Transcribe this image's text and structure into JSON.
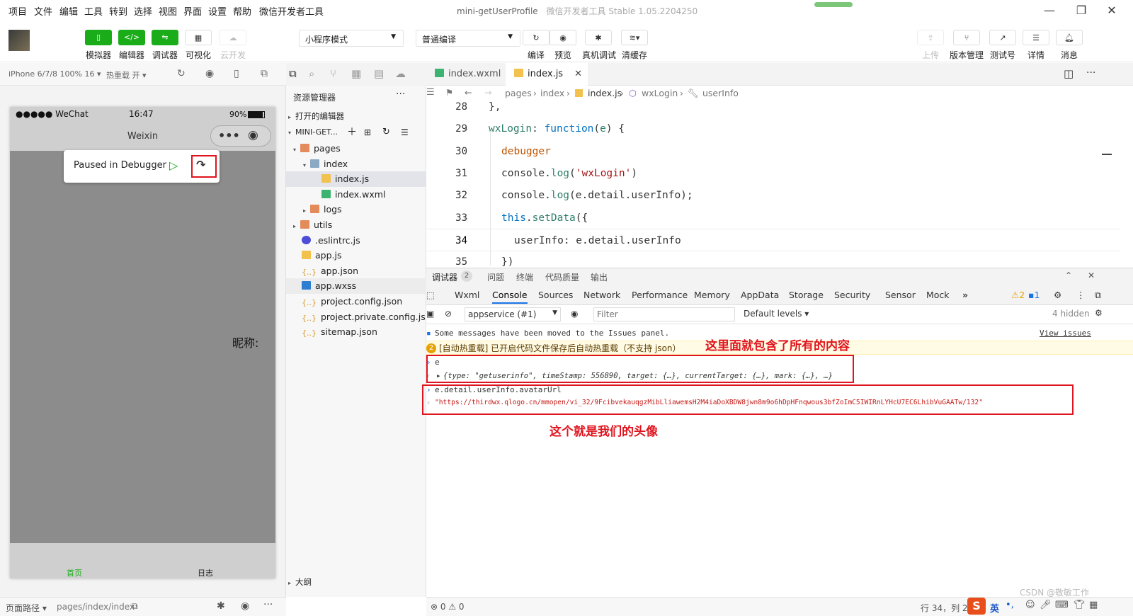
{
  "menu": [
    "项目",
    "文件",
    "编辑",
    "工具",
    "转到",
    "选择",
    "视图",
    "界面",
    "设置",
    "帮助",
    "微信开发者工具"
  ],
  "window": {
    "title": "mini-getUserProfile",
    "subtitle": "微信开发者工具 Stable 1.05.2204250"
  },
  "toolbar": {
    "buttons": [
      {
        "label": "模拟器",
        "icon": "phone-icon"
      },
      {
        "label": "编辑器",
        "icon": "code-icon"
      },
      {
        "label": "调试器",
        "icon": "debug-icon"
      },
      {
        "label": "可视化",
        "icon": "layout-icon"
      },
      {
        "label": "云开发",
        "icon": "cloud-icon"
      }
    ],
    "mode_select": "小程序模式",
    "compile_select": "普通编译",
    "actions": [
      "编译",
      "预览",
      "真机调试",
      "清缓存"
    ],
    "right_actions": [
      "上传",
      "版本管理",
      "测试号",
      "详情",
      "消息"
    ]
  },
  "simulator": {
    "device": "iPhone 6/7/8 100% 16",
    "hot_reload": "热重载 开",
    "status": {
      "carrier": "●●●●● WeChat",
      "time": "16:47",
      "battery": "90%"
    },
    "nav_title": "Weixin",
    "paused_text": "Paused in Debugger",
    "nickname_label": "昵称:",
    "tabs": [
      "首页",
      "日志"
    ]
  },
  "footer": {
    "path_label": "页面路径",
    "path": "pages/index/index",
    "errors": "0",
    "warnings": "0"
  },
  "explorer": {
    "title": "资源管理器",
    "open_editors": "打开的编辑器",
    "project": "MINI-GET...",
    "outline": "大纲",
    "tree": [
      {
        "name": "pages",
        "type": "folder",
        "depth": 1,
        "open": true
      },
      {
        "name": "index",
        "type": "folder2",
        "depth": 2,
        "open": true
      },
      {
        "name": "index.js",
        "type": "js",
        "depth": 3,
        "selected": true
      },
      {
        "name": "index.wxml",
        "type": "wxml",
        "depth": 3
      },
      {
        "name": "logs",
        "type": "folder",
        "depth": 2
      },
      {
        "name": "utils",
        "type": "folder",
        "depth": 1
      },
      {
        "name": ".eslintrc.js",
        "type": "eslint",
        "depth": 1
      },
      {
        "name": "app.js",
        "type": "js",
        "depth": 1
      },
      {
        "name": "app.json",
        "type": "json",
        "depth": 1
      },
      {
        "name": "app.wxss",
        "type": "wxss",
        "depth": 1,
        "hover": true
      },
      {
        "name": "project.config.json",
        "type": "json",
        "depth": 1
      },
      {
        "name": "project.private.config.js...",
        "type": "json",
        "depth": 1
      },
      {
        "name": "sitemap.json",
        "type": "json",
        "depth": 1
      }
    ]
  },
  "editor": {
    "tabs": [
      "index.wxml",
      "index.js"
    ],
    "breadcrumb": [
      "pages",
      "index",
      "index.js",
      "wxLogin",
      "userInfo"
    ],
    "lines": [
      {
        "n": "28",
        "parts": [
          [
            "id",
            "},"
          ]
        ]
      },
      {
        "n": "29",
        "parts": [
          [
            "fn",
            "wxLogin"
          ],
          [
            "id",
            ": "
          ],
          [
            "kw",
            "function"
          ],
          [
            "id",
            "("
          ],
          [
            "fn",
            "e"
          ],
          [
            "id",
            ") {"
          ]
        ]
      },
      {
        "n": "30",
        "parts": [
          [
            "dbg",
            "debugger"
          ]
        ]
      },
      {
        "n": "31",
        "parts": [
          [
            "id",
            "console."
          ],
          [
            "fn",
            "log"
          ],
          [
            "id",
            "("
          ],
          [
            "str",
            "'wxLogin'"
          ],
          [
            "id",
            ")"
          ]
        ]
      },
      {
        "n": "32",
        "parts": [
          [
            "id",
            "console."
          ],
          [
            "fn",
            "log"
          ],
          [
            "id",
            "(e.detail.userInfo);"
          ]
        ]
      },
      {
        "n": "33",
        "parts": [
          [
            "kw",
            "this"
          ],
          [
            "id",
            "."
          ],
          [
            "fn",
            "setData"
          ],
          [
            "id",
            "({"
          ]
        ]
      },
      {
        "n": "34",
        "parts": [
          [
            "id",
            "userInfo: e.detail.userInfo"
          ]
        ]
      },
      {
        "n": "35",
        "parts": [
          [
            "id",
            "})"
          ]
        ]
      }
    ]
  },
  "devtools": {
    "top_tabs": [
      "调试器",
      "问题",
      "终端",
      "代码质量",
      "输出"
    ],
    "badge": "2",
    "tabs": [
      "Wxml",
      "Console",
      "Sources",
      "Network",
      "Performance",
      "Memory",
      "AppData",
      "Storage",
      "Security",
      "Sensor",
      "Mock"
    ],
    "warn_count": "2",
    "info_count": "1",
    "context": "appservice (#1)",
    "filter_placeholder": "Filter",
    "levels": "Default levels",
    "hidden": "4 hidden",
    "console": {
      "moved_msg": "Some messages have been moved to the Issues panel.",
      "view_issues": "View issues",
      "warn_badge": "2",
      "warn_msg": "[自动热重载] 已开启代码文件保存后自动热重载（不支持 json）",
      "input1": "e",
      "output1": "{type: \"getuserinfo\", timeStamp: 556890, target: {…}, currentTarget: {…}, mark: {…}, …}",
      "input2": "e.detail.userInfo.avatarUrl",
      "output2": "\"https://thirdwx.qlogo.cn/mmopen/vi_32/9FcibvekauqgzMibLliawemsH2M4iaDoXBDW8jwn8m9o6hDpHFnqwous3bfZoImC5IWIRnLYHcU7EC6LhibVuGAATw/132\""
    },
    "annotation1": "这里面就包含了所有的内容",
    "annotation2": "这个就是我们的头像"
  },
  "status": {
    "cursor": "行 34，列 21",
    "ime": "英",
    "watermark": "CSDN @敬敏工作"
  }
}
